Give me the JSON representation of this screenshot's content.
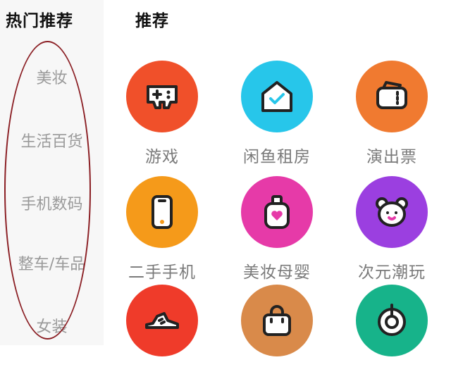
{
  "sidebar": {
    "title": "热门推荐",
    "items": [
      {
        "label": "美妆"
      },
      {
        "label": "生活百货"
      },
      {
        "label": "手机数码"
      },
      {
        "label": "整车/车品"
      },
      {
        "label": "女装"
      }
    ]
  },
  "main": {
    "title": "推荐",
    "tiles": [
      {
        "label": "游戏",
        "icon": "gamepad-icon",
        "color": "#f0502a"
      },
      {
        "label": "闲鱼租房",
        "icon": "house-check-icon",
        "color": "#27c6ea"
      },
      {
        "label": "演出票",
        "icon": "ticket-icon",
        "color": "#f07a30"
      },
      {
        "label": "二手手机",
        "icon": "phone-icon",
        "color": "#f59a1a"
      },
      {
        "label": "美妆母婴",
        "icon": "heart-bottle-icon",
        "color": "#e63aa8"
      },
      {
        "label": "次元潮玩",
        "icon": "bear-icon",
        "color": "#9b3fe0"
      },
      {
        "label": "",
        "icon": "sneaker-icon",
        "color": "#ef3b2a"
      },
      {
        "label": "",
        "icon": "bag-icon",
        "color": "#d98a4a"
      },
      {
        "label": "",
        "icon": "power-icon",
        "color": "#17b38a"
      }
    ]
  },
  "annotation": {
    "color": "#8b1f24"
  }
}
